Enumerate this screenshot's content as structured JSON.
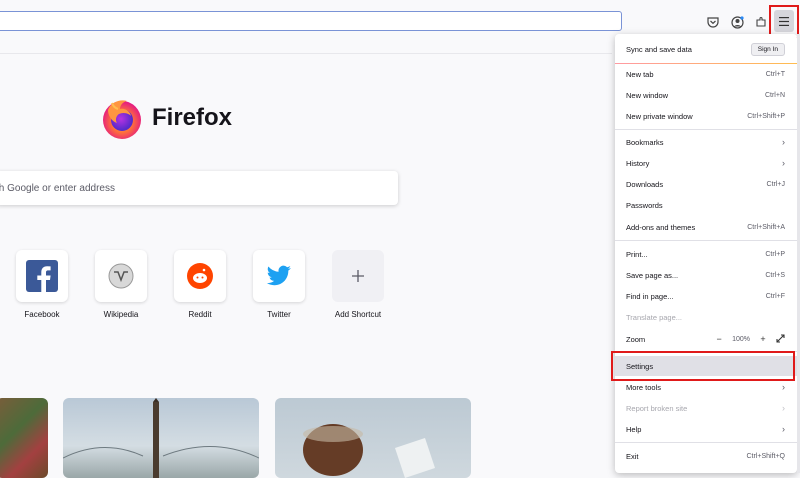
{
  "toolbar": {
    "icons": [
      "pocket-icon",
      "account-icon",
      "extensions-icon",
      "hamburger-menu-icon"
    ]
  },
  "newtab": {
    "brand": "Firefox",
    "search_placeholder": "th Google or enter address",
    "shortcuts": [
      {
        "label": "Facebook",
        "icon": "facebook-icon"
      },
      {
        "label": "Wikipedia",
        "icon": "wikipedia-icon"
      },
      {
        "label": "Reddit",
        "icon": "reddit-icon"
      },
      {
        "label": "Twitter",
        "icon": "twitter-icon"
      },
      {
        "label": "Add Shortcut",
        "icon": "plus-icon"
      }
    ]
  },
  "menu": {
    "sync": {
      "label": "Sync and save data",
      "button": "Sign In"
    },
    "new_tab": {
      "label": "New tab",
      "shortcut": "Ctrl+T"
    },
    "new_window": {
      "label": "New window",
      "shortcut": "Ctrl+N"
    },
    "new_private": {
      "label": "New private window",
      "shortcut": "Ctrl+Shift+P"
    },
    "bookmarks": {
      "label": "Bookmarks"
    },
    "history": {
      "label": "History"
    },
    "downloads": {
      "label": "Downloads",
      "shortcut": "Ctrl+J"
    },
    "passwords": {
      "label": "Passwords"
    },
    "addons": {
      "label": "Add-ons and themes",
      "shortcut": "Ctrl+Shift+A"
    },
    "print": {
      "label": "Print...",
      "shortcut": "Ctrl+P"
    },
    "save_page": {
      "label": "Save page as...",
      "shortcut": "Ctrl+S"
    },
    "find": {
      "label": "Find in page...",
      "shortcut": "Ctrl+F"
    },
    "translate": {
      "label": "Translate page..."
    },
    "zoom": {
      "label": "Zoom",
      "minus": "−",
      "value": "100%",
      "plus": "+"
    },
    "settings": {
      "label": "Settings"
    },
    "more_tools": {
      "label": "More tools"
    },
    "report": {
      "label": "Report broken site"
    },
    "help": {
      "label": "Help"
    },
    "exit": {
      "label": "Exit",
      "shortcut": "Ctrl+Shift+Q"
    }
  },
  "colors": {
    "highlight": "#e01a1a",
    "accent": "#7a93d6"
  }
}
